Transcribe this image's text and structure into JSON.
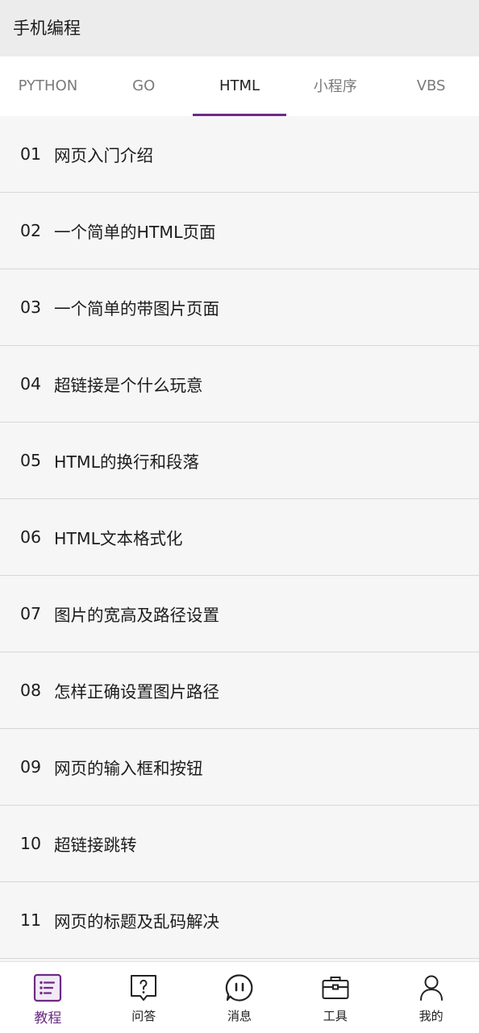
{
  "app": {
    "title": "手机编程",
    "accent_color": "#6c2b83"
  },
  "tabs": [
    {
      "label": "PYTHON",
      "active": false
    },
    {
      "label": "GO",
      "active": false
    },
    {
      "label": "HTML",
      "active": true
    },
    {
      "label": "小程序",
      "active": false
    },
    {
      "label": "VBS",
      "active": false
    }
  ],
  "lessons": [
    {
      "num": "01",
      "title": "网页入门介绍"
    },
    {
      "num": "02",
      "title": "一个简单的HTML页面"
    },
    {
      "num": "03",
      "title": "一个简单的带图片页面"
    },
    {
      "num": "04",
      "title": "超链接是个什么玩意"
    },
    {
      "num": "05",
      "title": "HTML的换行和段落"
    },
    {
      "num": "06",
      "title": "HTML文本格式化"
    },
    {
      "num": "07",
      "title": "图片的宽高及路径设置"
    },
    {
      "num": "08",
      "title": "怎样正确设置图片路径"
    },
    {
      "num": "09",
      "title": "网页的输入框和按钮"
    },
    {
      "num": "10",
      "title": "超链接跳转"
    },
    {
      "num": "11",
      "title": "网页的标题及乱码解决"
    }
  ],
  "bottom_nav": [
    {
      "label": "教程",
      "icon": "list-icon",
      "active": true
    },
    {
      "label": "问答",
      "icon": "question-icon",
      "active": false
    },
    {
      "label": "消息",
      "icon": "message-icon",
      "active": false
    },
    {
      "label": "工具",
      "icon": "toolbox-icon",
      "active": false
    },
    {
      "label": "我的",
      "icon": "user-icon",
      "active": false
    }
  ]
}
